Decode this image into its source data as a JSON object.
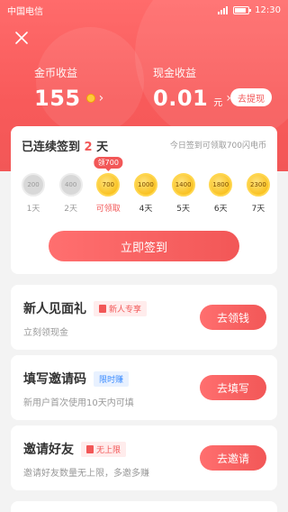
{
  "status_bar": {
    "carrier": "中国电信",
    "time": "12:30"
  },
  "header": {
    "coin_earnings": {
      "label": "金币收益",
      "value": "155"
    },
    "cash_earnings": {
      "label": "现金收益",
      "value": "0.01",
      "unit": "元"
    },
    "withdraw_label": "去提现"
  },
  "signin": {
    "title_prefix": "已连续签到 ",
    "streak_days": "2",
    "title_suffix": " 天",
    "hint": "今日签到可领取700闪电币",
    "today_bubble": "领700",
    "days": [
      {
        "coins": "200",
        "label": "1天",
        "state": "done"
      },
      {
        "coins": "400",
        "label": "2天",
        "state": "done"
      },
      {
        "coins": "700",
        "label": "可领取",
        "state": "today"
      },
      {
        "coins": "1000",
        "label": "4天",
        "state": "future"
      },
      {
        "coins": "1400",
        "label": "5天",
        "state": "future"
      },
      {
        "coins": "1800",
        "label": "6天",
        "state": "future"
      },
      {
        "coins": "2300",
        "label": "7天",
        "state": "future"
      }
    ],
    "button_label": "立即签到"
  },
  "tasks": [
    {
      "title": "新人见面礼",
      "tag": "新人专享",
      "tag_style": "red",
      "subtitle": "立刻领现金",
      "button": "去领钱"
    },
    {
      "title": "填写邀请码",
      "tag": "限时赚",
      "tag_style": "blue",
      "subtitle": "新用户首次使用10天内可填",
      "button": "去填写"
    },
    {
      "title": "邀请好友",
      "tag": "无上限",
      "tag_style": "red",
      "subtitle": "邀请好友数量无上限，多邀多赚",
      "button": "去邀请"
    }
  ],
  "colors": {
    "accent": "#f25757",
    "gold": "#f7b500",
    "blue_tag": "#3a8bff"
  }
}
